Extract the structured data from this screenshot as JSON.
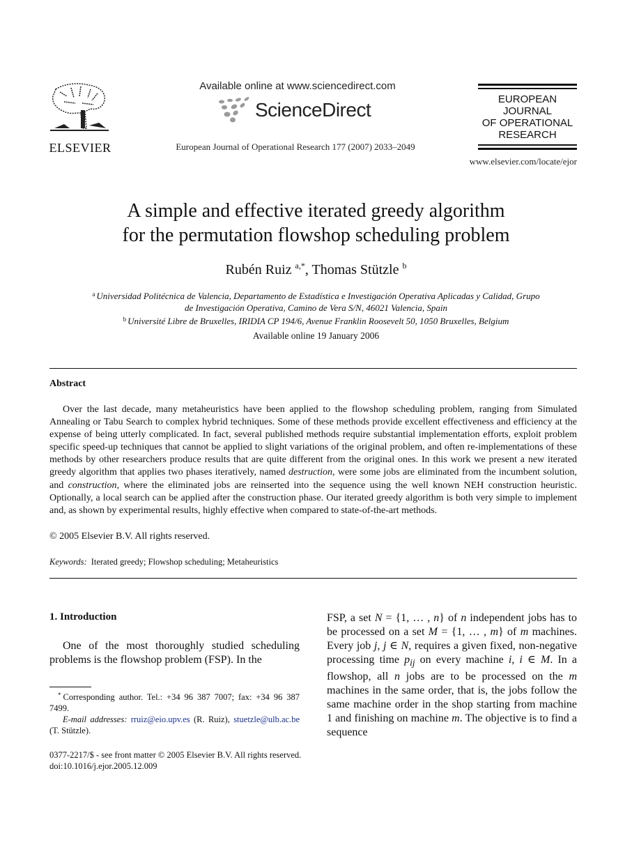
{
  "header": {
    "publisher_name": "ELSEVIER",
    "available_online": "Available online at www.sciencedirect.com",
    "sciencedirect_brand": "ScienceDirect",
    "journal_citation": "European Journal of Operational Research 177 (2007) 2033–2049",
    "journal_logo_lines": [
      "EUROPEAN",
      "JOURNAL",
      "OF OPERATIONAL",
      "RESEARCH"
    ],
    "journal_url": "www.elsevier.com/locate/ejor"
  },
  "article": {
    "title_line1": "A simple and effective iterated greedy algorithm",
    "title_line2": "for the permutation flowshop scheduling problem",
    "authors": [
      {
        "name": "Rubén Ruiz",
        "affil": "a,*"
      },
      {
        "name": "Thomas Stützle",
        "affil": "b"
      }
    ],
    "author_separator": ", ",
    "affiliations": [
      {
        "mark": "a",
        "line1": "Universidad Politécnica de Valencia, Departamento de Estadística e Investigación Operativa Aplicadas y Calidad, Grupo",
        "line2": "de Investigación Operativa, Camino de Vera S/N, 46021 Valencia, Spain"
      },
      {
        "mark": "b",
        "line1": "Université Libre de Bruxelles, IRIDIA CP 194/6, Avenue Franklin Roosevelt 50, 1050 Bruxelles, Belgium"
      }
    ],
    "available_online": "Available online 19 January 2006"
  },
  "abstract": {
    "heading": "Abstract",
    "part1": "Over the last decade, many metaheuristics have been applied to the flowshop scheduling problem, ranging from Simulated Annealing or Tabu Search to complex hybrid techniques. Some of these methods provide excellent effectiveness and efficiency at the expense of being utterly complicated. In fact, several published methods require substantial implementation efforts, exploit problem specific speed-up techniques that cannot be applied to slight variations of the original problem, and often re-implementations of these methods by other researchers produce results that are quite different from the original ones. In this work we present a new iterated greedy algorithm that applies two phases iteratively, named ",
    "em1": "destruction",
    "part2": ", were some jobs are eliminated from the incumbent solution, and ",
    "em2": "construction",
    "part3": ", where the eliminated jobs are reinserted into the sequence using the well known NEH construction heuristic. Optionally, a local search can be applied after the construction phase. Our iterated greedy algorithm is both very simple to implement and, as shown by experimental results, highly effective when compared to state-of-the-art methods.",
    "copyright": "© 2005 Elsevier B.V. All rights reserved."
  },
  "keywords": {
    "label": "Keywords:",
    "value": "Iterated greedy; Flowshop scheduling; Metaheuristics"
  },
  "introduction": {
    "heading": "1. Introduction",
    "left_text": "One of the most thoroughly studied scheduling problems is the flowshop problem (FSP). In the",
    "right_text": {
      "t1": "FSP, a set ",
      "m1": "N",
      "t2": " = {1, … , ",
      "m2": "n",
      "t3": "} of ",
      "m3": "n",
      "t4": " independent jobs has to be processed on a set ",
      "m4": "M",
      "t5": " = {1, … , ",
      "m5": "m",
      "t6": "} of ",
      "m6": "m",
      "t7": " machines. Every job ",
      "m7": "j, j",
      "t8": " ∈ ",
      "m8": "N",
      "t9": ", requires a given fixed, non-negative processing time ",
      "m9": "p",
      "m9sub": "ij",
      "t10": " on every machine ",
      "m10": "i, i",
      "t11": " ∈ ",
      "m11": "M",
      "t12": ". In a flowshop, all ",
      "m12": "n",
      "t13": " jobs are to be processed on the ",
      "m13": "m",
      "t14": " machines in the same order, that is, the jobs follow the same machine order in the shop starting from machine 1 and finishing on machine ",
      "m14": "m",
      "t15": ". The objective is to find a sequence"
    }
  },
  "footnotes": {
    "mark": "*",
    "corresponding": "Corresponding author. Tel.: +34 96 387 7007; fax: +34 96 387 7499.",
    "email_label": "E-mail addresses:",
    "email1": "rruiz@eio.upv.es",
    "email1_owner": " (R. Ruiz), ",
    "email2": "stuetzle@ulb.ac.be",
    "email2_owner": " (T. Stützle)."
  },
  "front_matter": {
    "issn_line": "0377-2217/$ - see front matter  © 2005 Elsevier B.V. All rights reserved.",
    "doi": "doi:10.1016/j.ejor.2005.12.009"
  },
  "colors": {
    "text": "#111111",
    "link": "#1a2f8a",
    "sd_dots": "#9a9a9a"
  }
}
